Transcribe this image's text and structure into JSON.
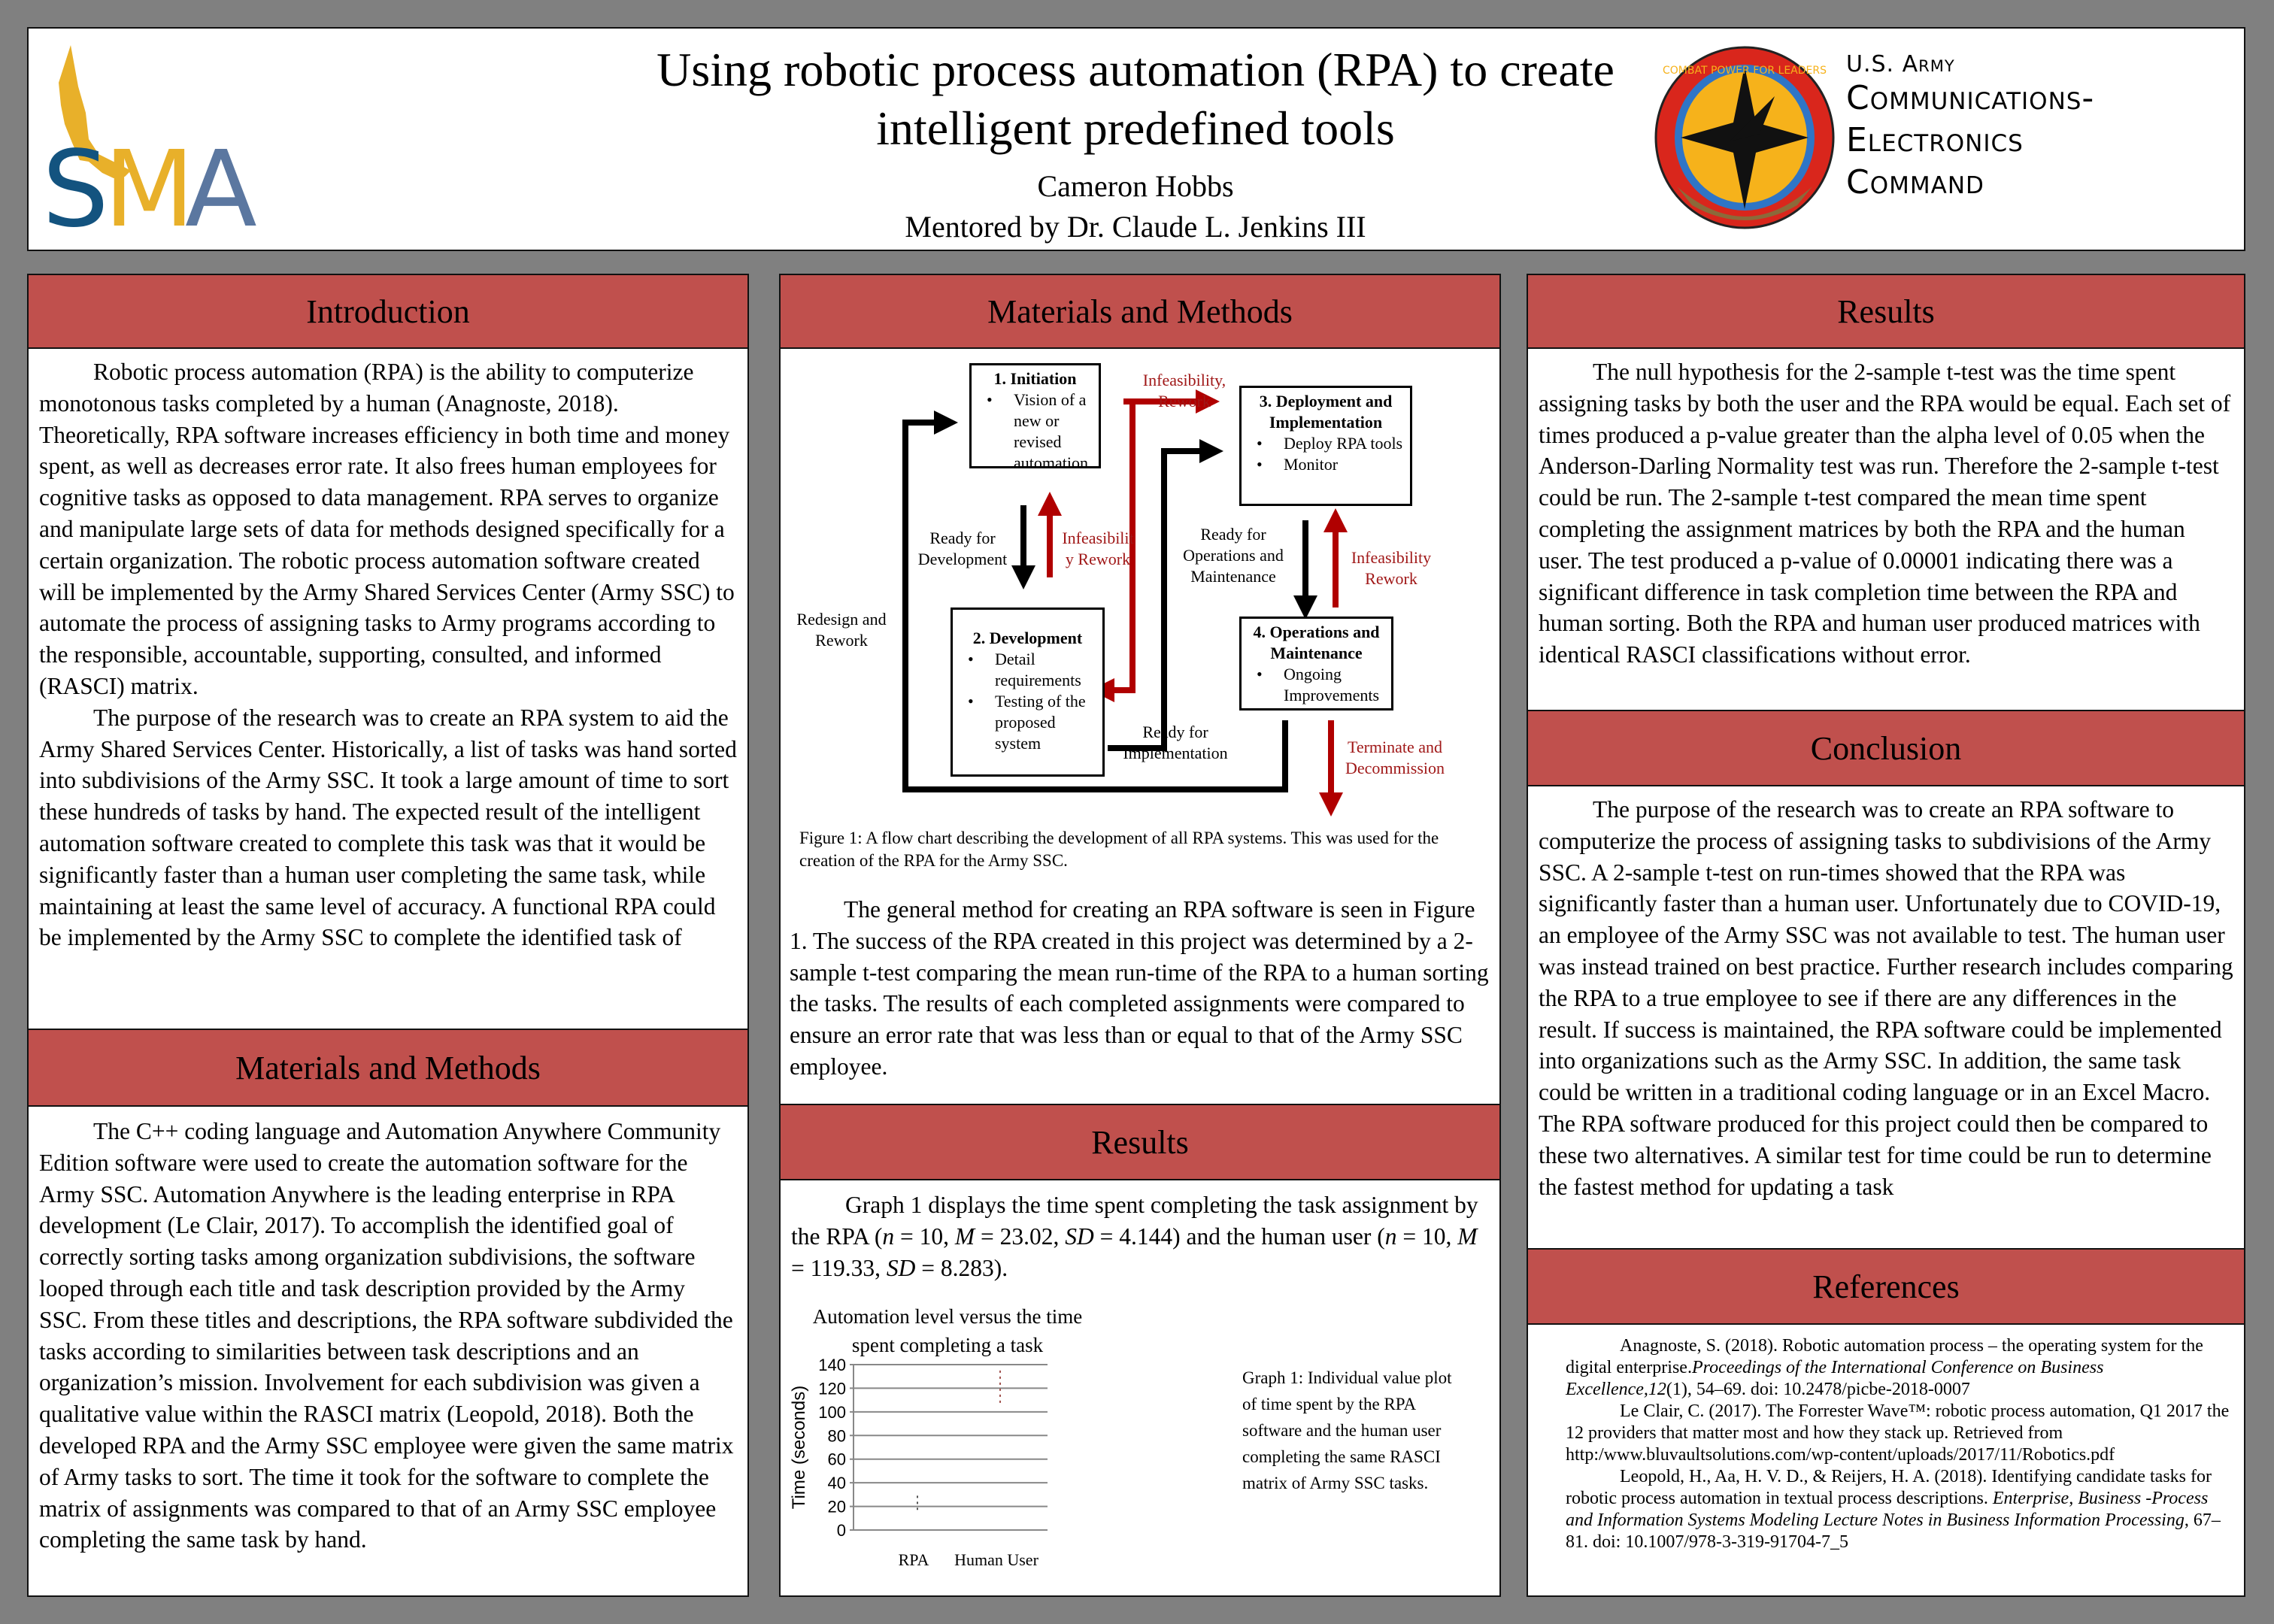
{
  "header": {
    "title": "Using robotic process automation (RPA) to create intelligent predefined tools",
    "author": "Cameron Hobbs",
    "mentor": "Mentored by Dr. Claude L. Jenkins III",
    "left_logo": {
      "icon": "sma-eagle-logo",
      "text": "SMA",
      "colors": {
        "S": "#13537f",
        "M": "#e8b02a",
        "A": "#5b77a0",
        "eagle": "#e8b02a"
      }
    },
    "right_logo": {
      "icon": "cecom-seal",
      "seal_motto": "COMBAT POWER FOR LEADERS",
      "line1": "U.S. Army",
      "line2": "Communications-",
      "line3": "Electronics",
      "line4": "Command"
    }
  },
  "colors": {
    "background": "#808080",
    "section_header": "#c0504d",
    "flow_red": "#a01818"
  },
  "sections": {
    "introduction": {
      "title": "Introduction",
      "paragraphs": [
        "Robotic process automation (RPA) is the ability to computerize monotonous tasks completed by a human (Anagnoste, 2018). Theoretically, RPA software increases efficiency in both time and money spent, as well as decreases error rate. It also frees human employees for cognitive tasks as opposed to data management. RPA serves to organize and manipulate large sets of data for methods designed specifically for a certain organization. The robotic process automation software created will be implemented by the Army Shared Services Center (Army SSC) to automate the process of assigning tasks to Army programs according to the responsible, accountable, supporting, consulted, and informed (RASCI) matrix.",
        "The purpose of the research was to create an RPA system to aid the Army Shared Services Center. Historically, a list of tasks was hand sorted into subdivisions of the Army SSC. It took a large amount of time to sort these hundreds of tasks by hand. The expected result of the intelligent automation software created to complete this task was that it would be significantly faster than a human user completing the same task, while maintaining at least the same level of accuracy. A functional RPA could be implemented by the Army SSC to complete the identified task of"
      ]
    },
    "methods_left": {
      "title": "Materials and Methods",
      "paragraphs": [
        "The C++ coding language and Automation Anywhere Community Edition software were used to create the automation software for the Army SSC. Automation Anywhere is the leading enterprise in RPA development (Le Clair, 2017). To accomplish the identified goal of correctly sorting tasks among organization subdivisions, the software looped through each title and task description provided by the Army SSC. From these titles and descriptions, the RPA software subdivided the tasks according to similarities between task descriptions and an organization’s mission. Involvement for each subdivision was given a qualitative value within the RASCI matrix (Leopold, 2018). Both the developed RPA and the Army SSC employee were given the same matrix of Army tasks to sort. The time it took for the software to complete the matrix of assignments was compared to that of an Army SSC employee completing the same task by hand."
      ]
    },
    "methods_center": {
      "title": "Materials and Methods",
      "flowchart": {
        "boxes": [
          {
            "id": "initiation",
            "title": "1. Initiation",
            "bullets": [
              "Vision of a new or revised automation"
            ]
          },
          {
            "id": "development",
            "title": "2. Development",
            "bullets": [
              "Detail requirements",
              "Testing of the proposed system"
            ]
          },
          {
            "id": "deployment",
            "title": "3. Deployment and Implementation",
            "bullets": [
              "Deploy RPA tools",
              "Monitor"
            ]
          },
          {
            "id": "operations",
            "title": "4. Operations and Maintenance",
            "bullets": [
              "Ongoing Improvements"
            ]
          }
        ],
        "labels": {
          "ready_dev": "Ready for Development",
          "infeas_1": "Infeasibilit y Rework",
          "infeas_top": "Infeasibility, Rework",
          "redesign": "Redesign and Rework",
          "ready_impl": "Ready for Implementation",
          "ready_ops": "Ready for Operations and Maintenance",
          "infeas_2": "Infeasibility Rework",
          "terminate": "Terminate and Decommission"
        }
      },
      "figure_caption": "Figure 1: A flow chart describing the development of all RPA systems. This was used for the creation of the RPA for the Army SSC.",
      "paragraph": "The general method for creating an RPA software is seen in Figure 1. The success of the RPA created in this project was determined by a 2-sample t-test comparing the mean run-time of the RPA to a human sorting the tasks. The results of each completed assignments were compared to ensure an error rate that was less than or equal to that of the Army SSC employee."
    },
    "results_center": {
      "title": "Results",
      "para_parts": {
        "a": "Graph 1 displays the time spent completing the task assignment by the RPA (",
        "n1": "n",
        "b": " = 10, ",
        "m1": "M",
        "c": " = 23.02, ",
        "sd1": "SD",
        "d": " = 4.144) and the human user (",
        "n2": "n",
        "e": " = 10, ",
        "m2": "M",
        "f": " = 119.33, ",
        "sd2": "SD",
        "g": " = 8.283)."
      },
      "graph_caption": "Graph 1: Individual value plot of time spent by the RPA software and the human user completing the same RASCI matrix of Army SSC tasks."
    },
    "results_right": {
      "title": "Results",
      "paragraph": "The null hypothesis for the 2-sample t-test was the time spent assigning tasks by both the user and the RPA would be equal. Each set of times produced a p-value greater than the alpha level of 0.05 when the Anderson-Darling Normality test was run. Therefore the 2-sample t-test could be run. The 2-sample t-test compared the mean time spent completing the assignment matrices by both the RPA and the human user. The test produced a p-value of 0.00001 indicating there was a significant difference in task completion time between the RPA and human sorting. Both the RPA and human user produced matrices with identical RASCI classifications without error."
    },
    "conclusion": {
      "title": "Conclusion",
      "paragraph": "The purpose of the research was to create an RPA software to computerize the process of assigning tasks to subdivisions of the Army SSC. A 2-sample t-test on run-times showed that the RPA was significantly faster than a human user. Unfortunately due to COVID-19, an employee of the Army SSC was not available to test. The human user was instead trained on best practice. Further research includes comparing the RPA to a true employee to see if there are any differences in the result. If success is maintained, the RPA software could be implemented into organizations such as the Army SSC. In addition, the same task could be written in a traditional coding language or in an Excel Macro. The RPA software produced for this project could then be compared to these two alternatives. A similar test for time could be run to determine the fastest method for updating a task"
    },
    "references": {
      "title": "References",
      "items": [
        {
          "plain": "Anagnoste, S. (2018). Robotic automation process – the operating system for the digital enterprise.",
          "italic": "Proceedings of the International Conference on Business Excellence,12",
          "tail": "(1), 54–69. doi: 10.2478/picbe-2018-0007"
        },
        {
          "plain": "Le Clair, C. (2017). The Forrester Wave™: robotic process automation, Q1 2017 the 12 providers that matter most and how they stack up. Retrieved from http:/www.bluvaultsolutions.com/wp-content/uploads/2017/11/Robotics.pdf",
          "italic": "",
          "tail": ""
        },
        {
          "plain": "Leopold, H., Aa, H. V. D., & Reijers, H. A. (2018). Identifying candidate tasks for robotic process automation in textual process descriptions. ",
          "italic": "Enterprise, Business -Process and Information Systems Modeling Lecture Notes in Business Information Processing",
          "tail": ", 67–81. doi: 10.1007/978-3-319-91704-7_5"
        }
      ]
    }
  },
  "chart_data": {
    "type": "scatter",
    "title": "Automation level versus the time spent completing a task",
    "xlabel": "",
    "ylabel": "Time (seconds)",
    "categories": [
      "RPA",
      "Human User"
    ],
    "ylim": [
      0,
      140
    ],
    "yticks": [
      0,
      20,
      40,
      60,
      80,
      100,
      120,
      140
    ],
    "grid": true,
    "legend": "none",
    "series": [
      {
        "name": "RPA",
        "n": 10,
        "mean": 23.02,
        "sd": 4.144,
        "approx_range": [
          17,
          29
        ],
        "color": "#555555"
      },
      {
        "name": "Human User",
        "n": 10,
        "mean": 119.33,
        "sd": 8.283,
        "approx_range": [
          105,
          135
        ],
        "color": "#a0524d"
      }
    ]
  }
}
